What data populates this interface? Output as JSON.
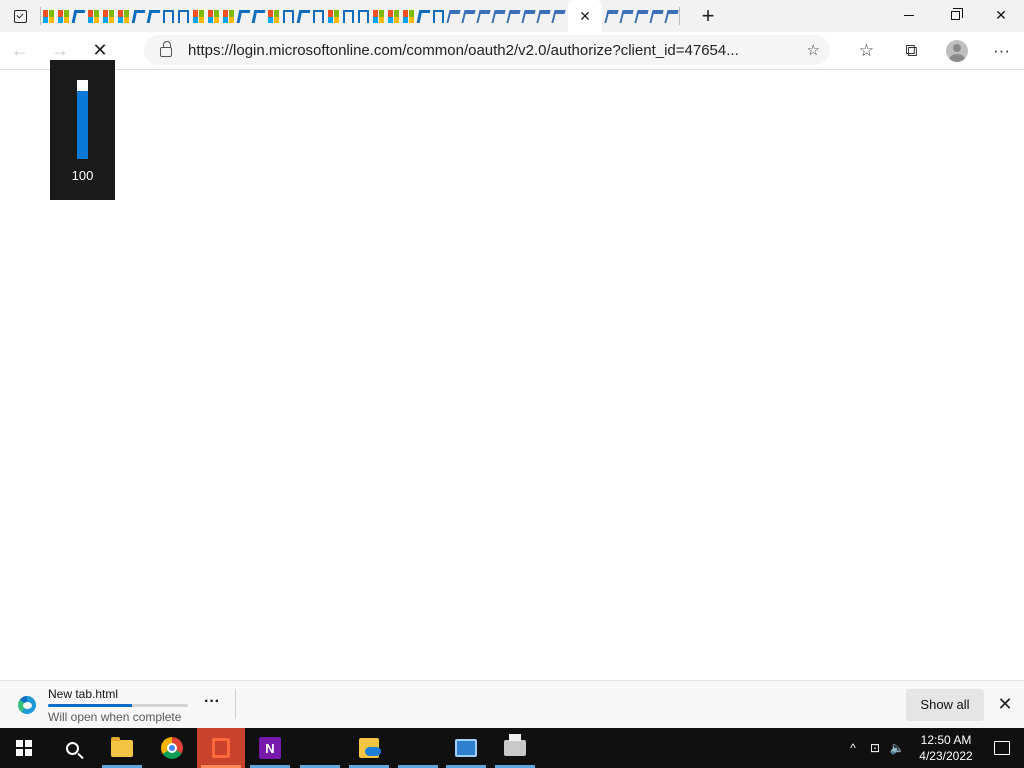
{
  "browser": {
    "address": {
      "url": "https://login.microsoftonline.com/common/oauth2/v2.0/authorize?client_id=47654..."
    },
    "active_tab_close": "✕",
    "new_tab": "+"
  },
  "overlay": {
    "meter_value": "100",
    "meter_level": 0.86
  },
  "download": {
    "file_name": "New tab.html",
    "status": "Will open when complete",
    "progress": 0.6,
    "more_label": "···",
    "show_all_label": "Show all",
    "close_label": "✕"
  },
  "taskbar": {
    "time": "12:50 AM",
    "date": "4/23/2022"
  }
}
